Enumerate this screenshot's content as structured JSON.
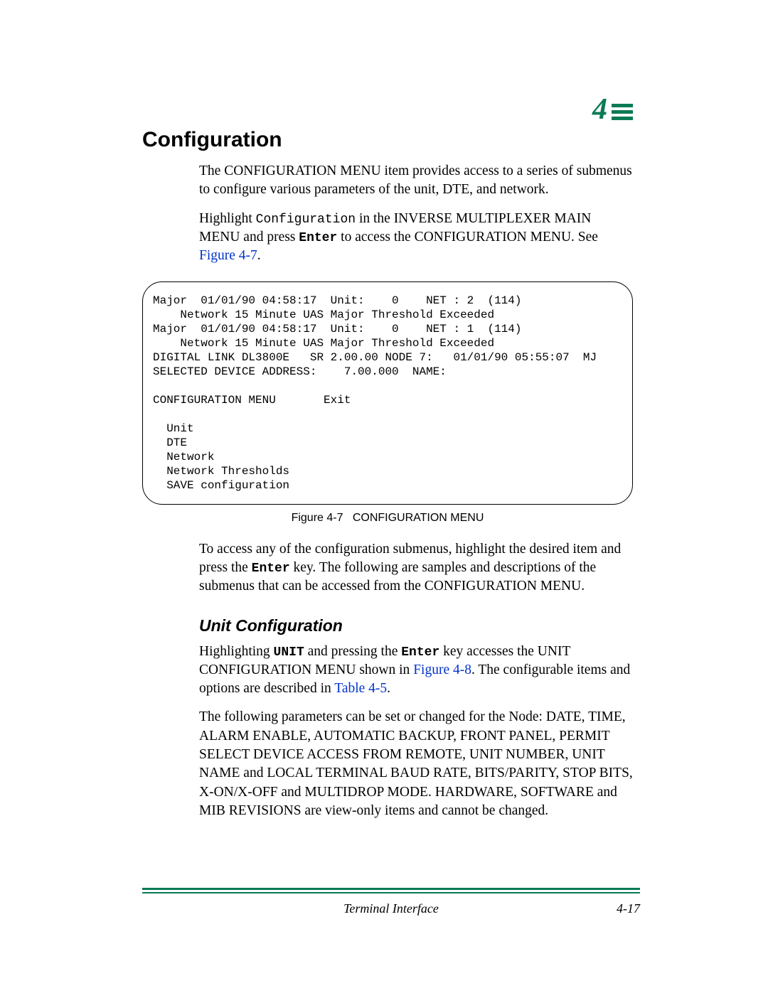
{
  "chapter": {
    "number": "4"
  },
  "section": {
    "title": "Configuration"
  },
  "intro": {
    "p1": "The CONFIGURATION MENU item provides access to a series of submenus to configure various parameters of the unit, DTE, and network.",
    "p2a": "Highlight ",
    "p2_code": "Configuration",
    "p2b": " in the INVERSE MULTIPLEXER MAIN MENU and press ",
    "p2_key": "Enter",
    "p2c": " to access the CONFIGURATION MENU. See ",
    "p2_link": "Figure 4-7",
    "p2d": "."
  },
  "terminal": "Major  01/01/90 04:58:17  Unit:    0    NET : 2  (114)\n    Network 15 Minute UAS Major Threshold Exceeded\nMajor  01/01/90 04:58:17  Unit:    0    NET : 1  (114)\n    Network 15 Minute UAS Major Threshold Exceeded\nDIGITAL LINK DL3800E   SR 2.00.00 NODE 7:   01/01/90 05:55:07  MJ\nSELECTED DEVICE ADDRESS:    7.00.000  NAME:\n\nCONFIGURATION MENU       Exit\n\n  Unit\n  DTE\n  Network\n  Network Thresholds\n  SAVE configuration",
  "figure": {
    "label": "Figure 4-7",
    "title": "CONFIGURATION MENU"
  },
  "after_fig": {
    "p1a": "To access any of the configuration submenus, highlight the desired item and press the ",
    "p1_key": "Enter",
    "p1b": "  key. The following are samples and descriptions of the submenus that can be accessed from the CONFIGURATION MENU."
  },
  "subsection": {
    "title": "Unit Configuration"
  },
  "unit": {
    "p1a": "Highlighting ",
    "p1_code": "UNIT",
    "p1b": " and pressing the ",
    "p1_key": "Enter",
    "p1c": " key accesses the UNIT CONFIGURATION MENU shown in ",
    "p1_link1": "Figure 4-8",
    "p1d": ". The configurable items and options are described in ",
    "p1_link2": "Table 4-5",
    "p1e": ".",
    "p2": "The following parameters can be set or changed for the Node: DATE, TIME, ALARM ENABLE, AUTOMATIC BACKUP, FRONT PANEL, PERMIT SELECT DEVICE ACCESS FROM REMOTE, UNIT NUMBER, UNIT NAME and LOCAL TERMINAL BAUD RATE, BITS/PARITY, STOP BITS, X-ON/X-OFF and MULTIDROP MODE. HARDWARE, SOFTWARE and MIB REVISIONS are view-only items and cannot be changed."
  },
  "footer": {
    "center": "Terminal Interface",
    "right": "4-17"
  }
}
